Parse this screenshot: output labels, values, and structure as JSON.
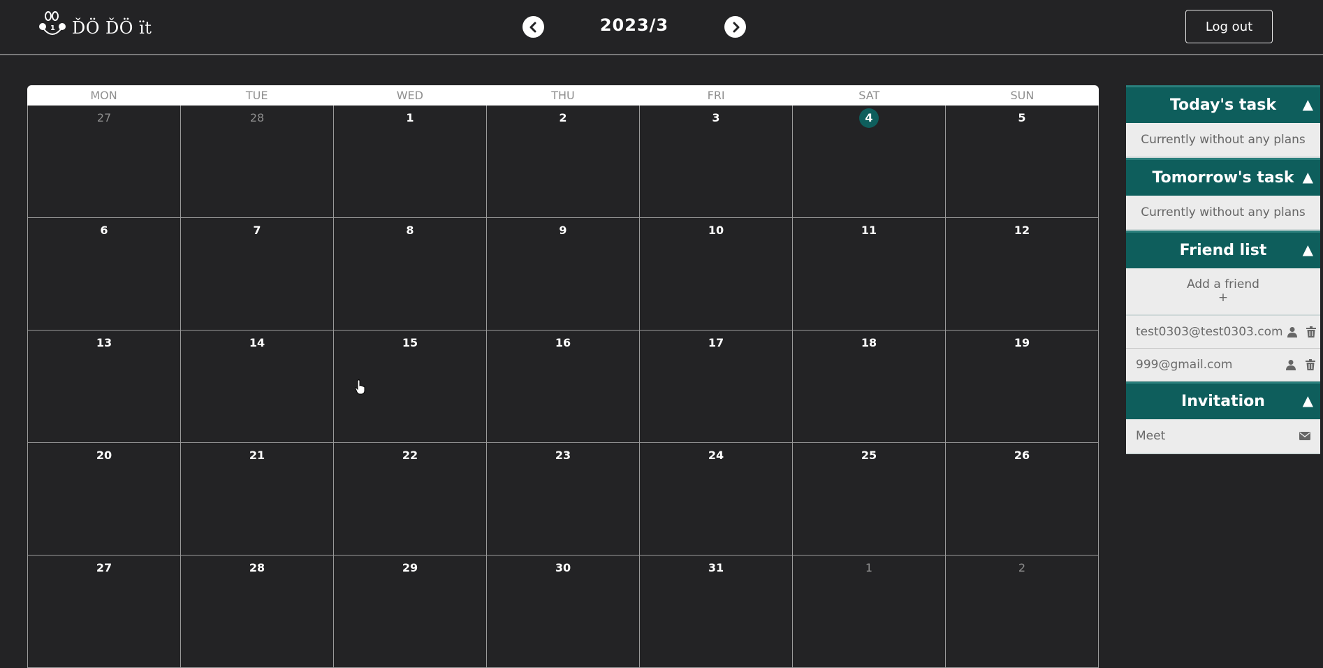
{
  "header": {
    "logo_text": "ĎÖ ĎÖ ït",
    "month_title": "2023/3",
    "logout_label": "Log out",
    "prev_icon": "chevron-left-icon",
    "next_icon": "chevron-right-icon"
  },
  "calendar": {
    "weekdays": [
      "MON",
      "TUE",
      "WED",
      "THU",
      "FRI",
      "SAT",
      "SUN"
    ],
    "today_color": "#0e5e5c",
    "days": [
      {
        "n": "27",
        "other": true
      },
      {
        "n": "28",
        "other": true
      },
      {
        "n": "1"
      },
      {
        "n": "2"
      },
      {
        "n": "3"
      },
      {
        "n": "4",
        "today": true
      },
      {
        "n": "5"
      },
      {
        "n": "6"
      },
      {
        "n": "7"
      },
      {
        "n": "8"
      },
      {
        "n": "9"
      },
      {
        "n": "10"
      },
      {
        "n": "11"
      },
      {
        "n": "12"
      },
      {
        "n": "13"
      },
      {
        "n": "14"
      },
      {
        "n": "15"
      },
      {
        "n": "16"
      },
      {
        "n": "17"
      },
      {
        "n": "18"
      },
      {
        "n": "19"
      },
      {
        "n": "20"
      },
      {
        "n": "21"
      },
      {
        "n": "22"
      },
      {
        "n": "23"
      },
      {
        "n": "24"
      },
      {
        "n": "25"
      },
      {
        "n": "26"
      },
      {
        "n": "27"
      },
      {
        "n": "28"
      },
      {
        "n": "29"
      },
      {
        "n": "30"
      },
      {
        "n": "31"
      },
      {
        "n": "1",
        "other": true
      },
      {
        "n": "2",
        "other": true
      }
    ]
  },
  "sidebar": {
    "accent_color": "#0e5e5c",
    "today": {
      "title": "Today's task",
      "empty": "Currently without any plans"
    },
    "tomorrow": {
      "title": "Tomorrow's task",
      "empty": "Currently without any plans"
    },
    "friends": {
      "title": "Friend list",
      "add_label": "Add a friend",
      "add_plus": "+",
      "items": [
        {
          "email": "test0303@test0303.com",
          "icons": [
            "person-icon",
            "trash-icon"
          ]
        },
        {
          "email": "999@gmail.com",
          "icons": [
            "person-icon",
            "trash-icon"
          ]
        }
      ]
    },
    "invitation": {
      "title": "Invitation",
      "items": [
        {
          "title": "Meet",
          "icon": "envelope-icon"
        }
      ]
    },
    "collapse_glyph": "▲"
  }
}
